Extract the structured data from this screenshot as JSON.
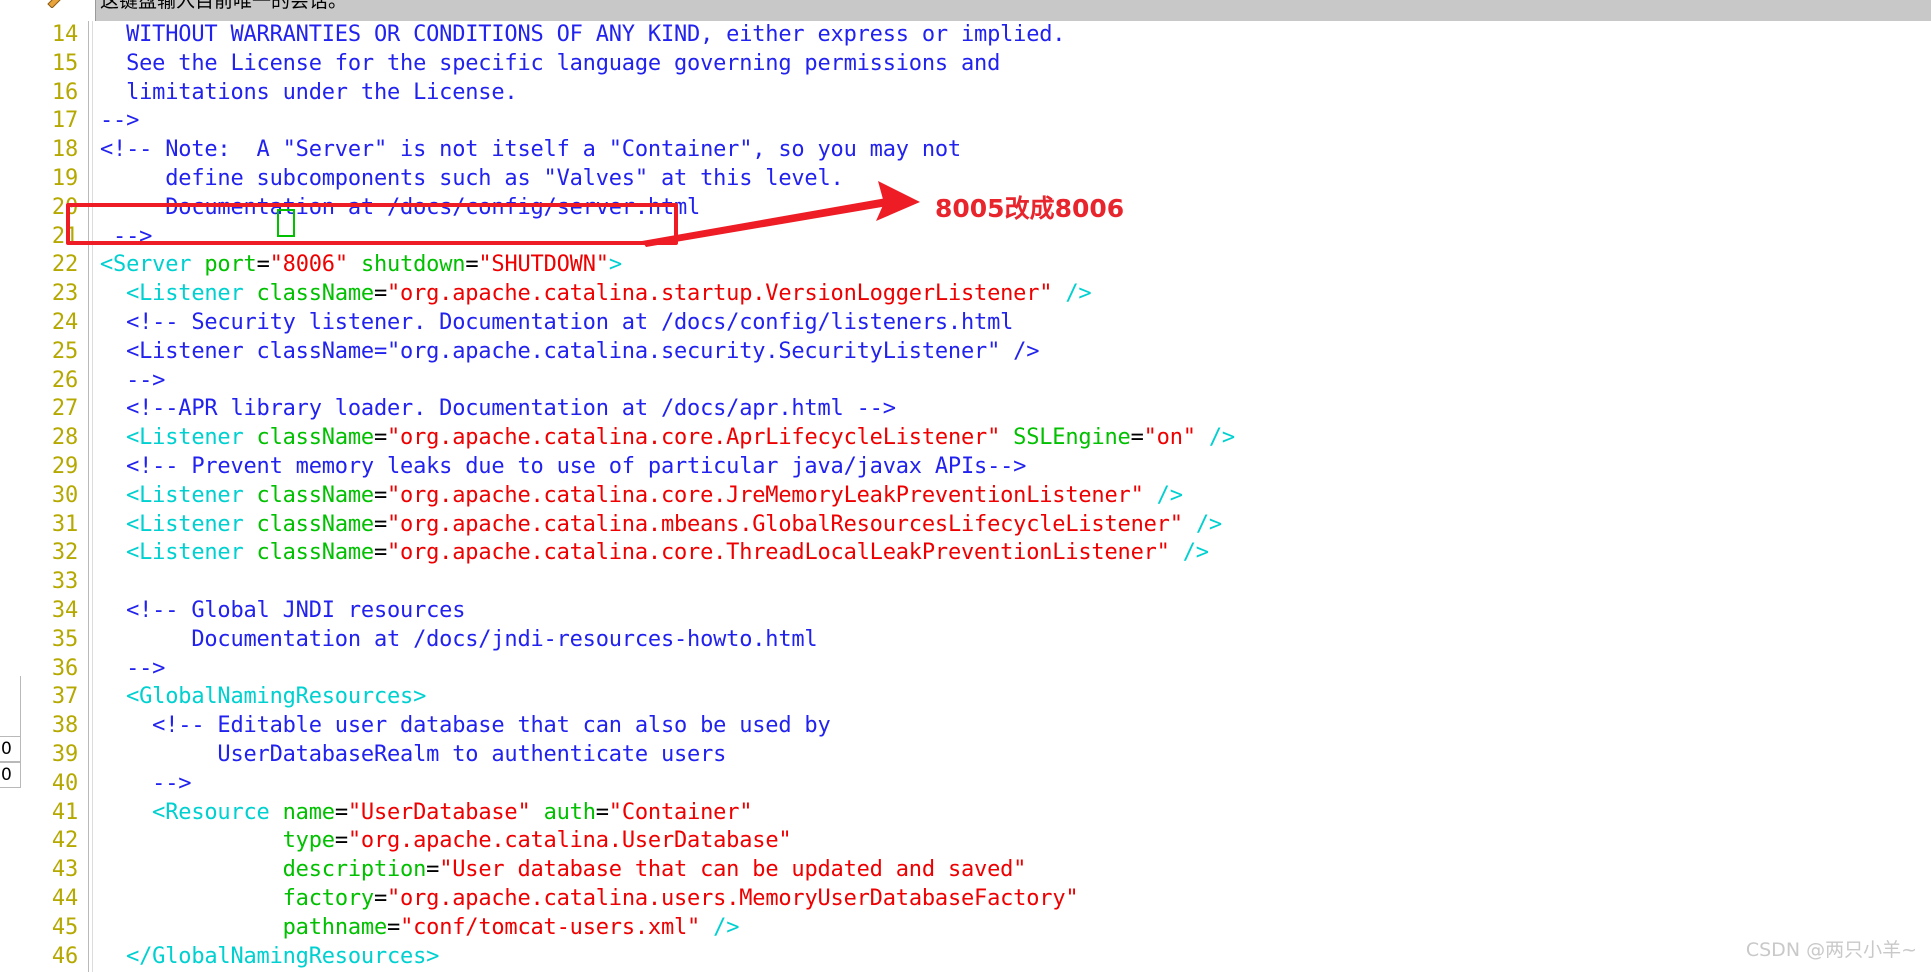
{
  "window": {
    "toolbar_hint_text": "这键盘输入目前唯一的会话。",
    "toolbar_icon": "wrench-icon"
  },
  "annotation": {
    "text": "8005改成8006",
    "color": "#e8242c",
    "arrow": "red-arrow-right",
    "highlight_box_color": "#ee1c25",
    "cursor_box_color": "#00c000"
  },
  "status": {
    "left_box_1": "0",
    "left_box_2": "0"
  },
  "watermark": {
    "text": "CSDN @两只小羊~"
  },
  "colors": {
    "line_number": "#b5a800",
    "comment": "#2222ee",
    "tag": "#00d0d0",
    "attribute": "#00c000",
    "value": "#ee0000",
    "plain": "#000000",
    "toolbar_bg": "#c8c8c8",
    "editor_bg": "#ffffff"
  },
  "editor": {
    "file_type": "xml",
    "first_visible_line": 14,
    "last_visible_line": 46,
    "lines": [
      {
        "n": "14",
        "tokens": [
          {
            "t": "  WITHOUT WARRANTIES OR CONDITIONS OF ANY KIND, either express or implied.",
            "c": "t-comment"
          }
        ]
      },
      {
        "n": "15",
        "tokens": [
          {
            "t": "  See the License for the specific language governing permissions and",
            "c": "t-comment"
          }
        ]
      },
      {
        "n": "16",
        "tokens": [
          {
            "t": "  limitations under the License.",
            "c": "t-comment"
          }
        ]
      },
      {
        "n": "17",
        "tokens": [
          {
            "t": "-->",
            "c": "t-comment"
          }
        ]
      },
      {
        "n": "18",
        "tokens": [
          {
            "t": "<!-- Note:  A \"Server\" is not itself a \"Container\", so you may not",
            "c": "t-comment"
          }
        ]
      },
      {
        "n": "19",
        "tokens": [
          {
            "t": "     define subcomponents such as \"Valves\" at this level.",
            "c": "t-comment"
          }
        ]
      },
      {
        "n": "20",
        "tokens": [
          {
            "t": "     Documentation at /docs/config/server.html",
            "c": "t-comment"
          }
        ]
      },
      {
        "n": "21",
        "tokens": [
          {
            "t": " -->",
            "c": "t-comment"
          }
        ]
      },
      {
        "n": "22",
        "tokens": [
          {
            "t": "<Server",
            "c": "t-tag"
          },
          {
            "t": " ",
            "c": "t-plain"
          },
          {
            "t": "port",
            "c": "t-attr"
          },
          {
            "t": "=",
            "c": "t-plain"
          },
          {
            "t": "\"8006\"",
            "c": "t-val"
          },
          {
            "t": " ",
            "c": "t-plain"
          },
          {
            "t": "shutdown",
            "c": "t-attr"
          },
          {
            "t": "=",
            "c": "t-plain"
          },
          {
            "t": "\"SHUTDOWN\"",
            "c": "t-val"
          },
          {
            "t": ">",
            "c": "t-tag"
          }
        ]
      },
      {
        "n": "23",
        "tokens": [
          {
            "t": "  <Listener",
            "c": "t-tag"
          },
          {
            "t": " ",
            "c": "t-plain"
          },
          {
            "t": "className",
            "c": "t-attr"
          },
          {
            "t": "=",
            "c": "t-plain"
          },
          {
            "t": "\"org.apache.catalina.startup.VersionLoggerListener\"",
            "c": "t-val"
          },
          {
            "t": " ",
            "c": "t-plain"
          },
          {
            "t": "/>",
            "c": "t-tag"
          }
        ]
      },
      {
        "n": "24",
        "tokens": [
          {
            "t": "  <!-- Security listener. Documentation at /docs/config/listeners.html",
            "c": "t-comment"
          }
        ]
      },
      {
        "n": "25",
        "tokens": [
          {
            "t": "  <Listener className=\"org.apache.catalina.security.SecurityListener\" />",
            "c": "t-comment"
          }
        ]
      },
      {
        "n": "26",
        "tokens": [
          {
            "t": "  -->",
            "c": "t-comment"
          }
        ]
      },
      {
        "n": "27",
        "tokens": [
          {
            "t": "  <!--APR library loader. Documentation at /docs/apr.html -->",
            "c": "t-comment"
          }
        ]
      },
      {
        "n": "28",
        "tokens": [
          {
            "t": "  <Listener",
            "c": "t-tag"
          },
          {
            "t": " ",
            "c": "t-plain"
          },
          {
            "t": "className",
            "c": "t-attr"
          },
          {
            "t": "=",
            "c": "t-plain"
          },
          {
            "t": "\"org.apache.catalina.core.AprLifecycleListener\"",
            "c": "t-val"
          },
          {
            "t": " ",
            "c": "t-plain"
          },
          {
            "t": "SSLEngine",
            "c": "t-attr"
          },
          {
            "t": "=",
            "c": "t-plain"
          },
          {
            "t": "\"on\"",
            "c": "t-val"
          },
          {
            "t": " ",
            "c": "t-plain"
          },
          {
            "t": "/>",
            "c": "t-tag"
          }
        ]
      },
      {
        "n": "29",
        "tokens": [
          {
            "t": "  <!-- Prevent memory leaks due to use of particular java/javax APIs-->",
            "c": "t-comment"
          }
        ]
      },
      {
        "n": "30",
        "tokens": [
          {
            "t": "  <Listener",
            "c": "t-tag"
          },
          {
            "t": " ",
            "c": "t-plain"
          },
          {
            "t": "className",
            "c": "t-attr"
          },
          {
            "t": "=",
            "c": "t-plain"
          },
          {
            "t": "\"org.apache.catalina.core.JreMemoryLeakPreventionListener\"",
            "c": "t-val"
          },
          {
            "t": " ",
            "c": "t-plain"
          },
          {
            "t": "/>",
            "c": "t-tag"
          }
        ]
      },
      {
        "n": "31",
        "tokens": [
          {
            "t": "  <Listener",
            "c": "t-tag"
          },
          {
            "t": " ",
            "c": "t-plain"
          },
          {
            "t": "className",
            "c": "t-attr"
          },
          {
            "t": "=",
            "c": "t-plain"
          },
          {
            "t": "\"org.apache.catalina.mbeans.GlobalResourcesLifecycleListener\"",
            "c": "t-val"
          },
          {
            "t": " ",
            "c": "t-plain"
          },
          {
            "t": "/>",
            "c": "t-tag"
          }
        ]
      },
      {
        "n": "32",
        "tokens": [
          {
            "t": "  <Listener",
            "c": "t-tag"
          },
          {
            "t": " ",
            "c": "t-plain"
          },
          {
            "t": "className",
            "c": "t-attr"
          },
          {
            "t": "=",
            "c": "t-plain"
          },
          {
            "t": "\"org.apache.catalina.core.ThreadLocalLeakPreventionListener\"",
            "c": "t-val"
          },
          {
            "t": " ",
            "c": "t-plain"
          },
          {
            "t": "/>",
            "c": "t-tag"
          }
        ]
      },
      {
        "n": "33",
        "tokens": [
          {
            "t": "",
            "c": "t-plain"
          }
        ]
      },
      {
        "n": "34",
        "tokens": [
          {
            "t": "  <!-- Global JNDI resources",
            "c": "t-comment"
          }
        ]
      },
      {
        "n": "35",
        "tokens": [
          {
            "t": "       Documentation at /docs/jndi-resources-howto.html",
            "c": "t-comment"
          }
        ]
      },
      {
        "n": "36",
        "tokens": [
          {
            "t": "  -->",
            "c": "t-comment"
          }
        ]
      },
      {
        "n": "37",
        "tokens": [
          {
            "t": "  <GlobalNamingResources>",
            "c": "t-tag"
          }
        ]
      },
      {
        "n": "38",
        "tokens": [
          {
            "t": "    <!-- Editable user database that can also be used by",
            "c": "t-comment"
          }
        ]
      },
      {
        "n": "39",
        "tokens": [
          {
            "t": "         UserDatabaseRealm to authenticate users",
            "c": "t-comment"
          }
        ]
      },
      {
        "n": "40",
        "tokens": [
          {
            "t": "    -->",
            "c": "t-comment"
          }
        ]
      },
      {
        "n": "41",
        "tokens": [
          {
            "t": "    <Resource",
            "c": "t-tag"
          },
          {
            "t": " ",
            "c": "t-plain"
          },
          {
            "t": "name",
            "c": "t-attr"
          },
          {
            "t": "=",
            "c": "t-plain"
          },
          {
            "t": "\"UserDatabase\"",
            "c": "t-val"
          },
          {
            "t": " ",
            "c": "t-plain"
          },
          {
            "t": "auth",
            "c": "t-attr"
          },
          {
            "t": "=",
            "c": "t-plain"
          },
          {
            "t": "\"Container\"",
            "c": "t-val"
          }
        ]
      },
      {
        "n": "42",
        "tokens": [
          {
            "t": "              ",
            "c": "t-plain"
          },
          {
            "t": "type",
            "c": "t-attr"
          },
          {
            "t": "=",
            "c": "t-plain"
          },
          {
            "t": "\"org.apache.catalina.UserDatabase\"",
            "c": "t-val"
          }
        ]
      },
      {
        "n": "43",
        "tokens": [
          {
            "t": "              ",
            "c": "t-plain"
          },
          {
            "t": "description",
            "c": "t-attr"
          },
          {
            "t": "=",
            "c": "t-plain"
          },
          {
            "t": "\"User database that can be updated and saved\"",
            "c": "t-val"
          }
        ]
      },
      {
        "n": "44",
        "tokens": [
          {
            "t": "              ",
            "c": "t-plain"
          },
          {
            "t": "factory",
            "c": "t-attr"
          },
          {
            "t": "=",
            "c": "t-plain"
          },
          {
            "t": "\"org.apache.catalina.users.MemoryUserDatabaseFactory\"",
            "c": "t-val"
          }
        ]
      },
      {
        "n": "45",
        "tokens": [
          {
            "t": "              ",
            "c": "t-plain"
          },
          {
            "t": "pathname",
            "c": "t-attr"
          },
          {
            "t": "=",
            "c": "t-plain"
          },
          {
            "t": "\"conf/tomcat-users.xml\"",
            "c": "t-val"
          },
          {
            "t": " ",
            "c": "t-plain"
          },
          {
            "t": "/>",
            "c": "t-tag"
          }
        ]
      },
      {
        "n": "46",
        "tokens": [
          {
            "t": "  </GlobalNamingResources>",
            "c": "t-tag"
          }
        ]
      }
    ]
  }
}
